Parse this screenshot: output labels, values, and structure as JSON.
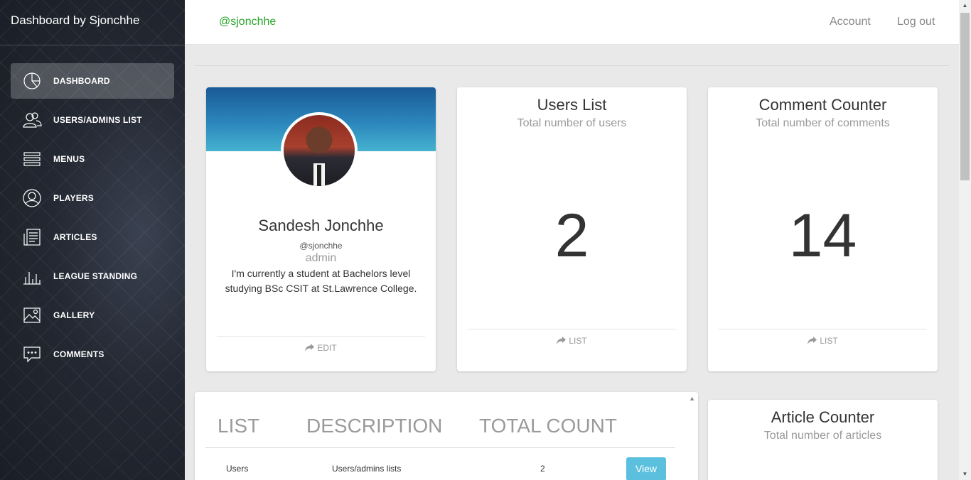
{
  "sidebar": {
    "brand": "Dashboard by Sjonchhe",
    "items": [
      {
        "label": "DASHBOARD",
        "icon": "pie-chart-icon"
      },
      {
        "label": "USERS/ADMINS LIST",
        "icon": "users-icon"
      },
      {
        "label": "MENUS",
        "icon": "menu-lines-icon"
      },
      {
        "label": "PLAYERS",
        "icon": "user-icon"
      },
      {
        "label": "ARTICLES",
        "icon": "article-icon"
      },
      {
        "label": "LEAGUE STANDING",
        "icon": "bar-chart-icon"
      },
      {
        "label": "GALLERY",
        "icon": "image-icon"
      },
      {
        "label": "COMMENTS",
        "icon": "comment-icon"
      }
    ]
  },
  "topbar": {
    "user": "@sjonchhe",
    "account": "Account",
    "logout": "Log out"
  },
  "profile": {
    "name": "Sandesh Jonchhe",
    "handle": "@sjonchhe",
    "role": "admin",
    "bio": "I'm currently a student at Bachelors level studying BSc CSIT at St.Lawrence College.",
    "action": "EDIT"
  },
  "users_card": {
    "title": "Users List",
    "subtitle": "Total number of users",
    "count": "2",
    "action": "LIST"
  },
  "comment_card": {
    "title": "Comment Counter",
    "subtitle": "Total number of comments",
    "count": "14",
    "action": "LIST"
  },
  "article_card": {
    "title": "Article Counter",
    "subtitle": "Total number of articles"
  },
  "list_table": {
    "headers": [
      "LIST",
      "DESCRIPTION",
      "TOTAL COUNT"
    ],
    "rows": [
      {
        "list": "Users",
        "description": "Users/admins lists",
        "count": "2",
        "button": "View"
      }
    ]
  },
  "colors": {
    "accent_green": "#2aa52a",
    "button_info": "#5bc0de",
    "sidebar_dark": "#232832"
  }
}
